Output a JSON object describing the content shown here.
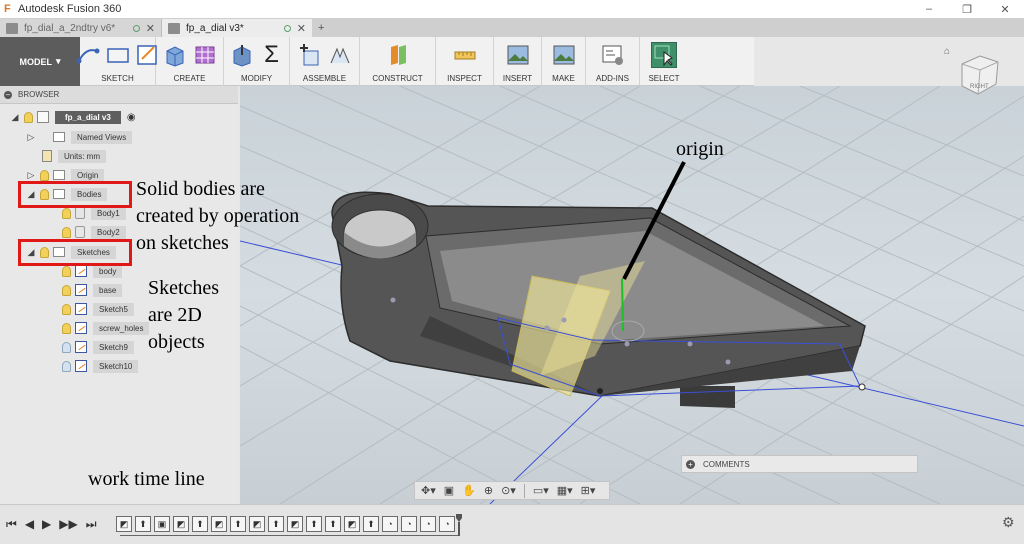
{
  "window": {
    "title": "Autodesk Fusion 360",
    "controls": [
      "–",
      "❐",
      "✕"
    ]
  },
  "tabs": [
    {
      "label": "fp_dial_a_2ndtry v6*",
      "active": false
    },
    {
      "label": "fp_a_dial v3*",
      "active": true
    }
  ],
  "tab_add": "+",
  "toolbar": {
    "model": "MODEL",
    "groups": [
      "SKETCH",
      "CREATE",
      "MODIFY",
      "ASSEMBLE",
      "CONSTRUCT",
      "INSPECT",
      "INSERT",
      "MAKE",
      "ADD-INS",
      "SELECT"
    ]
  },
  "navcube": {
    "face": "RIGHT"
  },
  "browser": {
    "header": "BROWSER",
    "root": "fp_a_dial v3",
    "items": {
      "named_views": "Named Views",
      "units": "Units: mm",
      "origin": "Origin",
      "bodies": "Bodies",
      "body1": "Body1",
      "body2": "Body2",
      "sketches": "Sketches",
      "sk_body": "body",
      "sk_base": "base",
      "sk5": "Sketch5",
      "sk_screw": "screw_holes",
      "sk9": "Sketch9",
      "sk10": "Sketch10"
    }
  },
  "annotations": {
    "origin": "origin",
    "solid_line1": "Solid bodies are",
    "solid_line2": "created by operation",
    "solid_line3": "on sketches",
    "sketch_line1": "Sketches",
    "sketch_line2": "are 2D",
    "sketch_line3": "objects",
    "timeline": "work time line"
  },
  "comments": "COMMENTS",
  "colors": {
    "highlight_red": "#e01818",
    "model_bg": "#5c5c5c",
    "viewport_bg": "#ccd5da",
    "axis_blue": "#3b4fd6",
    "axis_green": "#1fbf2a",
    "plane_yellow": "#efe59a"
  },
  "timeline_icons": [
    "sketch",
    "extrude",
    "body",
    "sketch",
    "extrude",
    "sketch",
    "extrude",
    "sketch",
    "extrude",
    "sketch",
    "extrude",
    "extrude",
    "sketch",
    "extrude",
    "fillet",
    "fillet",
    "fillet",
    "fillet"
  ]
}
